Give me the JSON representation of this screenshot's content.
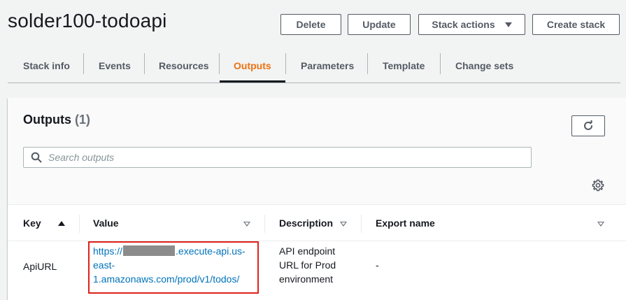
{
  "header": {
    "title": "solder100-todoapi",
    "buttons": {
      "delete": "Delete",
      "update": "Update",
      "stack_actions": "Stack actions",
      "create_stack": "Create stack"
    }
  },
  "tabs": [
    {
      "label": "Stack info"
    },
    {
      "label": "Events"
    },
    {
      "label": "Resources"
    },
    {
      "label": "Outputs",
      "active": true
    },
    {
      "label": "Parameters"
    },
    {
      "label": "Template"
    },
    {
      "label": "Change sets"
    }
  ],
  "outputs": {
    "title": "Outputs",
    "count": "(1)",
    "search_placeholder": "Search outputs",
    "columns": {
      "key": "Key",
      "value": "Value",
      "description": "Description",
      "export_name": "Export name"
    },
    "rows": [
      {
        "key": "ApiURL",
        "value_line1_prefix": "https://",
        "value_line1_suffix": ".execute-api.us-",
        "value_line2": "east-",
        "value_line3": "1.amazonaws.com/prod/v1/todos/",
        "description_lines": [
          "API endpoint",
          "URL for Prod",
          "environment"
        ],
        "export_name": "-"
      }
    ]
  },
  "colors": {
    "active_tab": "#ec7211",
    "link": "#0073bb",
    "highlight_border": "#e0211c"
  },
  "icons": [
    "caret-down-icon",
    "refresh-icon",
    "search-icon",
    "gear-icon",
    "sort-ascending-icon",
    "filter-icon"
  ]
}
